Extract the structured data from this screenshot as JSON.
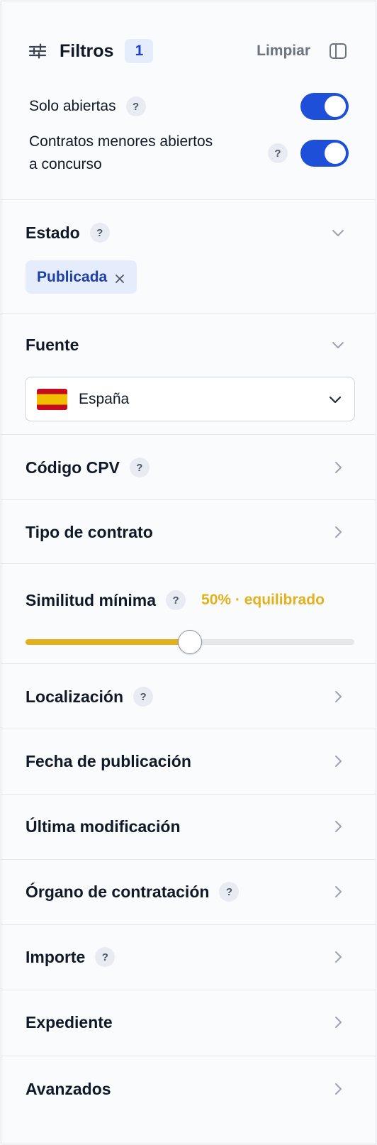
{
  "header": {
    "title": "Filtros",
    "active_count": "1",
    "clear_label": "Limpiar",
    "filter_icon": "sliders-icon",
    "layout_icon": "sidebar-panel-icon"
  },
  "toggles": [
    {
      "label": "Solo abiertas",
      "help": "?",
      "on": true
    },
    {
      "label_line1": "Contratos menores abiertos",
      "label_line2": "a concurso",
      "help": "?",
      "on": true
    }
  ],
  "sections": {
    "estado": {
      "title": "Estado",
      "help": "?",
      "expanded": true,
      "chip": "Publicada"
    },
    "fuente": {
      "title": "Fuente",
      "expanded": true,
      "selected": "España",
      "flag": "spain-flag-icon"
    },
    "cpv": {
      "title": "Código CPV",
      "help": "?"
    },
    "tipo": {
      "title": "Tipo de contrato"
    },
    "similitud": {
      "title": "Similitud mínima",
      "help": "?",
      "value_label": "50% · equilibrado",
      "value": 0.5
    },
    "localizacion": {
      "title": "Localización",
      "help": "?"
    },
    "fecha": {
      "title": "Fecha de publicación"
    },
    "modificacion": {
      "title": "Última modificación"
    },
    "organo": {
      "title": "Órgano de contratación",
      "help": "?"
    },
    "importe": {
      "title": "Importe",
      "help": "?"
    },
    "expediente": {
      "title": "Expediente"
    },
    "avanzados": {
      "title": "Avanzados"
    }
  },
  "colors": {
    "accent": "#1d4fd8",
    "slider": "#e2b11b",
    "chip_bg": "#e5ecfb",
    "chip_text": "#1d3fa8"
  }
}
